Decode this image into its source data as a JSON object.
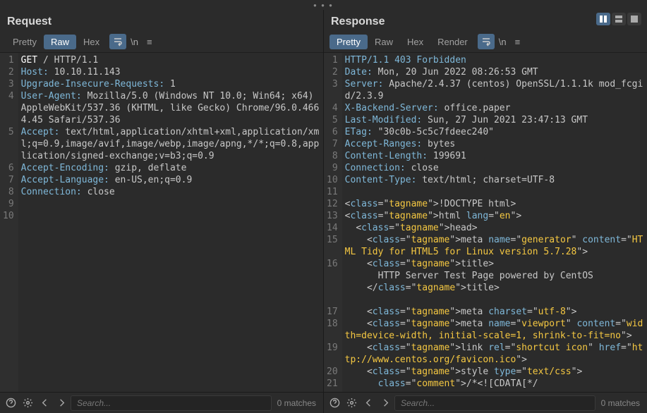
{
  "view_controls": [
    "split",
    "top-bottom",
    "single"
  ],
  "request": {
    "title": "Request",
    "tabs": [
      "Pretty",
      "Raw",
      "Hex"
    ],
    "active_tab": "Raw",
    "lines": [
      {
        "n": 1,
        "type": "reqline",
        "method": "GET",
        "path": "/",
        "proto": "HTTP/1.1"
      },
      {
        "n": 2,
        "type": "header",
        "name": "Host",
        "value": "10.10.11.143"
      },
      {
        "n": 3,
        "type": "header",
        "name": "Upgrade-Insecure-Requests",
        "value": "1"
      },
      {
        "n": 4,
        "type": "header",
        "name": "User-Agent",
        "value": "Mozilla/5.0 (Windows NT 10.0; Win64; x64) AppleWebKit/537.36 (KHTML, like Gecko) Chrome/96.0.4664.45 Safari/537.36"
      },
      {
        "n": 5,
        "type": "header",
        "name": "Accept",
        "value": "text/html,application/xhtml+xml,application/xml;q=0.9,image/avif,image/webp,image/apng,*/*;q=0.8,application/signed-exchange;v=b3;q=0.9"
      },
      {
        "n": 6,
        "type": "header",
        "name": "Accept-Encoding",
        "value": "gzip, deflate"
      },
      {
        "n": 7,
        "type": "header",
        "name": "Accept-Language",
        "value": "en-US,en;q=0.9"
      },
      {
        "n": 8,
        "type": "header",
        "name": "Connection",
        "value": "close"
      },
      {
        "n": 9,
        "type": "blank"
      },
      {
        "n": 10,
        "type": "blank"
      }
    ],
    "search_placeholder": "Search...",
    "matches": "0 matches"
  },
  "response": {
    "title": "Response",
    "tabs": [
      "Pretty",
      "Raw",
      "Hex",
      "Render"
    ],
    "active_tab": "Pretty",
    "lines": [
      {
        "n": 1,
        "type": "statusline",
        "proto": "HTTP/1.1",
        "code": "403",
        "reason": "Forbidden"
      },
      {
        "n": 2,
        "type": "header",
        "name": "Date",
        "value": "Mon, 20 Jun 2022 08:26:53 GMT"
      },
      {
        "n": 3,
        "type": "header",
        "name": "Server",
        "value": "Apache/2.4.37 (centos) OpenSSL/1.1.1k mod_fcgid/2.3.9"
      },
      {
        "n": 4,
        "type": "header",
        "name": "X-Backend-Server",
        "value": "office.paper"
      },
      {
        "n": 5,
        "type": "header",
        "name": "Last-Modified",
        "value": "Sun, 27 Jun 2021 23:47:13 GMT"
      },
      {
        "n": 6,
        "type": "header",
        "name": "ETag",
        "value": "\"30c0b-5c5c7fdeec240\""
      },
      {
        "n": 7,
        "type": "header",
        "name": "Accept-Ranges",
        "value": "bytes"
      },
      {
        "n": 8,
        "type": "header",
        "name": "Content-Length",
        "value": "199691"
      },
      {
        "n": 9,
        "type": "header",
        "name": "Connection",
        "value": "close"
      },
      {
        "n": 10,
        "type": "header",
        "name": "Content-Type",
        "value": "text/html; charset=UTF-8"
      },
      {
        "n": 11,
        "type": "blank"
      },
      {
        "n": 12,
        "type": "html",
        "raw": "<!DOCTYPE html>"
      },
      {
        "n": 13,
        "type": "html",
        "raw": "<html lang=\"en\">"
      },
      {
        "n": 14,
        "type": "html",
        "raw": "  <head>"
      },
      {
        "n": 15,
        "type": "html",
        "raw": "    <meta name=\"generator\" content=\"HTML Tidy for HTML5 for Linux version 5.7.28\">"
      },
      {
        "n": 16,
        "type": "html",
        "raw": "    <title>\n      HTTP Server Test Page powered by CentOS\n    </title>"
      },
      {
        "n": 17,
        "type": "html",
        "raw": "    <meta charset=\"utf-8\">"
      },
      {
        "n": 18,
        "type": "html",
        "raw": "    <meta name=\"viewport\" content=\"width=device-width, initial-scale=1, shrink-to-fit=no\">"
      },
      {
        "n": 19,
        "type": "html",
        "raw": "    <link rel=\"shortcut icon\" href=\"http://www.centos.org/favicon.ico\">"
      },
      {
        "n": 20,
        "type": "html",
        "raw": "    <style type=\"text/css\">"
      },
      {
        "n": 21,
        "type": "html",
        "raw": "      /*<![CDATA[*/"
      }
    ],
    "search_placeholder": "Search...",
    "matches": "0 matches"
  }
}
